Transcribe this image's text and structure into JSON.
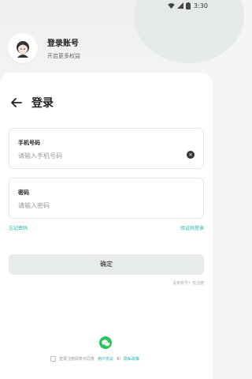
{
  "status_bar": {
    "time": "3:30"
  },
  "profile": {
    "title": "登录账号",
    "subtitle": "开启更多权益"
  },
  "login": {
    "heading": "登录"
  },
  "phone_field": {
    "label": "手机号码",
    "placeholder": "请输入手机号码"
  },
  "password_field": {
    "label": "密码",
    "placeholder": "请输入密码"
  },
  "links": {
    "forgot": "忘记密码",
    "sms_login": "验证码登录",
    "register": "没有账号？去注册"
  },
  "confirm_button": {
    "label": "确定"
  },
  "agreement": {
    "prefix": "登录注册即表示同意",
    "user_agreement": "用户协议",
    "and": "和",
    "privacy": "隐私政策"
  },
  "colors": {
    "accent": "#1fb4b0",
    "wechat": "#2dc35a"
  }
}
